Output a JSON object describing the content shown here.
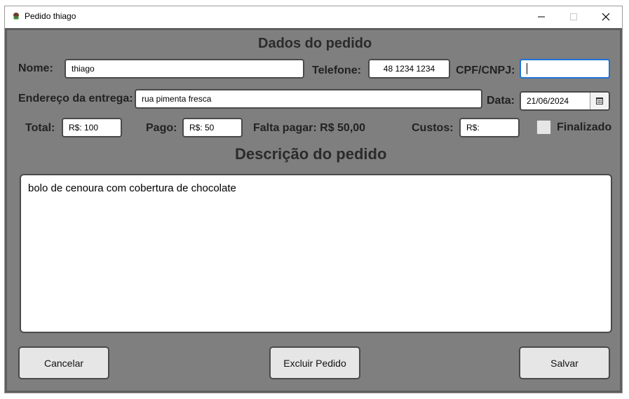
{
  "window": {
    "title": "Pedido thiago"
  },
  "form": {
    "heading": "Dados do pedido",
    "nome_label": "Nome:",
    "nome_value": "thiago",
    "telefone_label": "Telefone:",
    "telefone_value": "48 1234 1234",
    "cpf_label": "CPF/CNPJ:",
    "cpf_value": "",
    "endereco_label": "Endereço da entrega:",
    "endereco_value": "rua pimenta fresca",
    "data_label": "Data:",
    "data_value": "21/06/2024",
    "total_label": "Total:",
    "total_value": "R$: 100",
    "pago_label": "Pago:",
    "pago_value": "R$: 50",
    "falta_pagar": "Falta pagar: R$ 50,00",
    "custos_label": "Custos:",
    "custos_value": "R$:",
    "finalizado_label": "Finalizado",
    "finalizado_checked": false
  },
  "descricao": {
    "heading": "Descrição do pedido",
    "text": "bolo de cenoura com cobertura de chocolate"
  },
  "buttons": {
    "cancelar": "Cancelar",
    "excluir": "Excluir Pedido",
    "salvar": "Salvar"
  },
  "colors": {
    "panel_bg": "#7f7f7f",
    "focus_border": "#1e73d6"
  }
}
